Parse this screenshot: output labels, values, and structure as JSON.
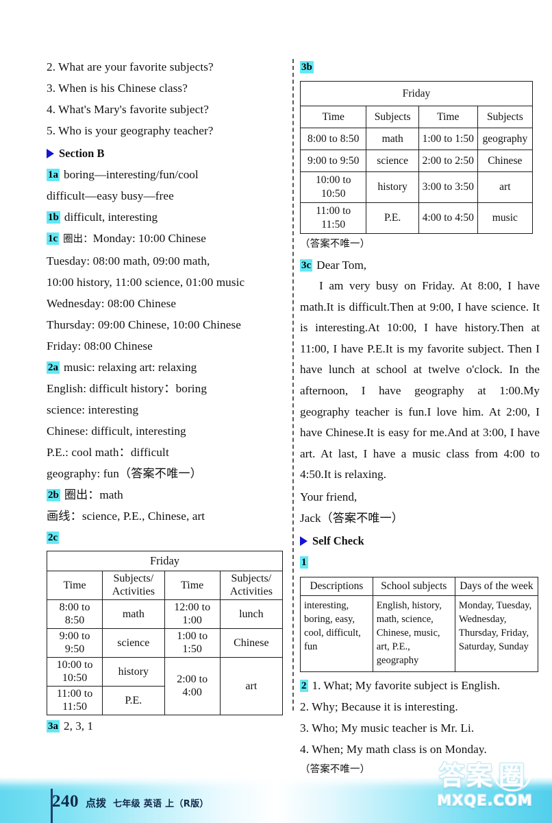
{
  "page": {
    "number": "240",
    "brand": "点拨",
    "subtitle": "七年级 英语 上（R版）",
    "watermark_cn": "答案",
    "watermark_cn_ring": "圈",
    "watermark_en": "MXQE.COM",
    "accent_tag_color": "#63e8f5",
    "marker_color": "#1414d2",
    "footer_color": "#63d8ef"
  },
  "left_column": {
    "questions": [
      "2. What are your favorite subjects?",
      "3. When is his Chinese class?",
      "4. What's Mary's favorite subject?",
      "5. Who is your geography teacher?"
    ],
    "section_b_label": "Section B",
    "items": {
      "i1a": {
        "tag": "1a",
        "line1": "boring—interesting/fun/cool",
        "line2": "difficult—easy    busy—free"
      },
      "i1b": {
        "tag": "1b",
        "text": "difficult, interesting"
      },
      "i1c": {
        "tag": "1c",
        "prefix": "圈出：",
        "lines": [
          "Monday: 10:00 Chinese",
          "Tuesday: 08:00 math, 09:00 math,",
          "10:00 history, 11:00 science, 01:00 music",
          "Wednesday: 08:00 Chinese",
          "Thursday: 09:00 Chinese, 10:00 Chinese",
          "Friday: 08:00 Chinese"
        ]
      },
      "i2a": {
        "tag": "2a",
        "lines": [
          "music: relaxing    art: relaxing",
          "English: difficult    history：boring",
          "science: interesting",
          "Chinese: difficult, interesting",
          "P.E.: cool    math：difficult",
          "geography: fun（答案不唯一）"
        ]
      },
      "i2b": {
        "tag": "2b",
        "line1": "圈出：math",
        "line2": "画线：science, P.E., Chinese, art"
      },
      "i2c": {
        "tag": "2c"
      },
      "i3a": {
        "tag": "3a",
        "text": "2, 3, 1"
      }
    },
    "table_2c": {
      "title": "Friday",
      "headers": [
        "Time",
        "Subjects/ Activities",
        "Time",
        "Subjects/ Activities"
      ],
      "header_left_time": "Time",
      "header_left_subj": [
        "Subjects/",
        "Activities"
      ],
      "header_right_time": "Time",
      "header_right_subj": [
        "Subjects/",
        "Activities"
      ],
      "rows": [
        {
          "t1": [
            "8:00 to",
            "8:50"
          ],
          "s1": "math",
          "t2": [
            "12:00 to",
            "1:00"
          ],
          "s2": "lunch"
        },
        {
          "t1": [
            "9:00 to",
            "9:50"
          ],
          "s1": "science",
          "t2": [
            "1:00 to",
            "1:50"
          ],
          "s2": "Chinese"
        },
        {
          "t1": [
            "10:00 to",
            "10:50"
          ],
          "s1": "history",
          "t2": [
            "2:00 to",
            "4:00"
          ],
          "s2": "art"
        },
        {
          "t1": [
            "11:00 to",
            "11:50"
          ],
          "s1": "P.E.",
          "t2": "",
          "s2": ""
        }
      ]
    }
  },
  "right_column": {
    "items": {
      "i3b": {
        "tag": "3b",
        "note": "（答案不唯一）"
      },
      "i3c": {
        "tag": "3c",
        "greeting": "Dear Tom,"
      },
      "self_check_label": "Self Check",
      "i1": {
        "tag": "1"
      },
      "i2": {
        "tag": "2",
        "note": "（答案不唯一）"
      }
    },
    "table_3b": {
      "title": "Friday",
      "headers": [
        "Time",
        "Subjects",
        "Time",
        "Subjects"
      ],
      "rows": [
        {
          "t1": "8:00 to 8:50",
          "s1": "math",
          "t2": "1:00 to 1:50",
          "s2": "geography"
        },
        {
          "t1": "9:00 to 9:50",
          "s1": "science",
          "t2": "2:00 to 2:50",
          "s2": "Chinese"
        },
        {
          "t1": "10:00 to 10:50",
          "s1": "history",
          "t2": "3:00 to 3:50",
          "s2": "art"
        },
        {
          "t1": "11:00 to 11:50",
          "s1": "P.E.",
          "t2": "4:00 to 4:50",
          "s2": "music"
        }
      ]
    },
    "letter": {
      "body": "I am very busy on Friday. At 8:00, I have math.It is difficult.Then at 9:00, I have science. It is interesting.At 10:00, I have history.Then at 11:00, I have P.E.It is my favorite subject. Then I have lunch at school at twelve o'clock. In the afternoon, I have geography at 1:00.My geography teacher is fun.I love him. At 2:00, I have Chinese.It is easy for me.And at 3:00, I have art. At last, I have a music class from 4:00 to 4:50.It is relaxing.",
      "closing": "Your friend,",
      "signature": "Jack（答案不唯一）"
    },
    "table_selfcheck": {
      "headers": [
        "Descriptions",
        "School subjects",
        "Days of the week"
      ],
      "cells": [
        "interesting, boring, easy, cool, difficult, fun",
        "English, history, math, science, Chinese, music, art, P.E., geography",
        "Monday, Tuesday, Wednesday, Thursday, Friday, Saturday, Sunday"
      ]
    },
    "answers_2": [
      "1. What; My favorite subject is English.",
      "2. Why; Because it is interesting.",
      "3. Who; My music teacher is Mr. Li.",
      "4. When; My math class is on Monday."
    ]
  }
}
